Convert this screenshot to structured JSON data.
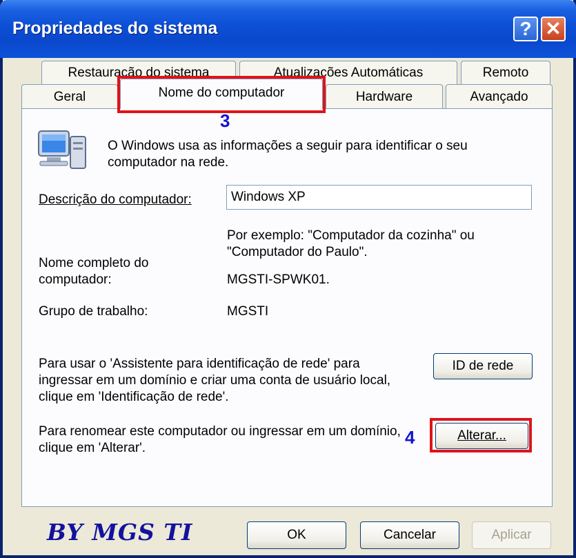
{
  "window": {
    "title": "Propriedades do sistema",
    "help_glyph": "?",
    "close_glyph": "✕"
  },
  "tabs_row_back": [
    {
      "label": "Restauração do sistema"
    },
    {
      "label": "Atualizações Automáticas"
    },
    {
      "label": "Remoto"
    }
  ],
  "tabs_row_front": [
    {
      "label": "Geral"
    },
    {
      "label": "Nome do computador",
      "active": true
    },
    {
      "label": "Hardware"
    },
    {
      "label": "Avançado"
    }
  ],
  "markers": {
    "step3": "3",
    "step4": "4"
  },
  "content": {
    "intro_text": "O Windows usa as informações a seguir para identificar o seu computador na rede.",
    "description_label": "Descrição do computador:",
    "description_value": "Windows XP",
    "example_text": "Por exemplo: \"Computador da cozinha\" ou \"Computador do Paulo\".",
    "fullname_label": "Nome completo do computador:",
    "fullname_value": "MGSTI-SPWK01.",
    "workgroup_label": "Grupo de trabalho:",
    "workgroup_value": "MGSTI",
    "network_id_text": "Para usar o 'Assistente para identificação de rede' para ingressar em um domínio e criar uma conta de usuário local, clique em 'Identificação de rede'.",
    "network_id_button": "ID de rede",
    "rename_text": "Para renomear este computador ou ingressar em um domínio, clique em 'Alterar'.",
    "change_button": "Alterar..."
  },
  "footer": {
    "brand": "BY MGS TI",
    "ok": "OK",
    "cancel": "Cancelar",
    "apply": "Aplicar"
  },
  "colors": {
    "title_bar": "#0c4fd6",
    "highlight_red": "#e0131a",
    "marker_blue": "#1414d2",
    "brand_blue": "#12129e"
  }
}
